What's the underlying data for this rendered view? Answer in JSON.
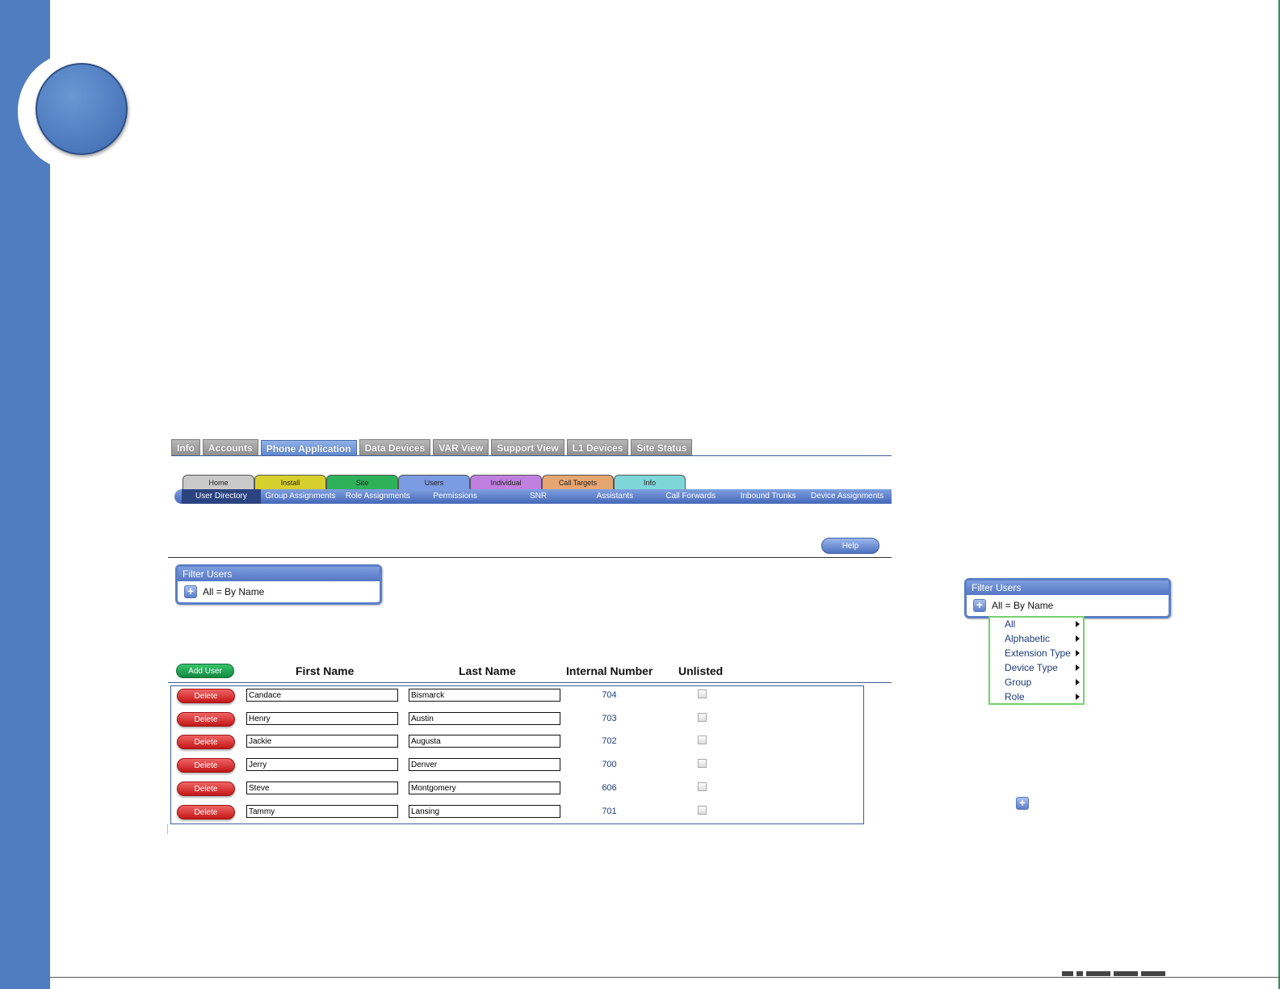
{
  "top_tabs": [
    {
      "label": "Info",
      "active": false
    },
    {
      "label": "Accounts",
      "active": false
    },
    {
      "label": "Phone Application",
      "active": true
    },
    {
      "label": "Data Devices",
      "active": false
    },
    {
      "label": "VAR View",
      "active": false
    },
    {
      "label": "Support View",
      "active": false
    },
    {
      "label": "L1 Devices",
      "active": false
    },
    {
      "label": "Site Status",
      "active": false
    }
  ],
  "section_tabs": [
    {
      "label": "Home",
      "color": "#c9c9c9"
    },
    {
      "label": "Install",
      "color": "#d7cf2e"
    },
    {
      "label": "Site",
      "color": "#2fb15a"
    },
    {
      "label": "Users",
      "color": "#7b9be2"
    },
    {
      "label": "Individual",
      "color": "#c080e0"
    },
    {
      "label": "Call Targets",
      "color": "#e6a672"
    },
    {
      "label": "Info",
      "color": "#7ed6d8"
    }
  ],
  "sub_nav": [
    {
      "label": "User Directory",
      "active": true
    },
    {
      "label": "Group Assignments",
      "active": false
    },
    {
      "label": "Role Assignments",
      "active": false
    },
    {
      "label": "Permissions",
      "active": false
    },
    {
      "label": "SNR",
      "active": false
    },
    {
      "label": "Assistants",
      "active": false
    },
    {
      "label": "Call Forwards",
      "active": false
    },
    {
      "label": "Inbound Trunks",
      "active": false
    },
    {
      "label": "Device Assignments",
      "active": false
    }
  ],
  "help_label": "Help",
  "filter": {
    "title": "Filter Users",
    "value": "All = By Name"
  },
  "filter_right": {
    "title": "Filter Users",
    "value": "All = By Name"
  },
  "add_user_label": "Add User",
  "columns": {
    "first_name": "First Name",
    "last_name": "Last Name",
    "internal_number": "Internal Number",
    "unlisted": "Unlisted"
  },
  "delete_label": "Delete",
  "users": [
    {
      "first": "Candace",
      "last": "Bismarck",
      "number": "704",
      "unlisted": false
    },
    {
      "first": "Henry",
      "last": "Austin",
      "number": "703",
      "unlisted": false
    },
    {
      "first": "Jackie",
      "last": "Augusta",
      "number": "702",
      "unlisted": false
    },
    {
      "first": "Jerry",
      "last": "Denver",
      "number": "700",
      "unlisted": false
    },
    {
      "first": "Steve",
      "last": "Montgomery",
      "number": "606",
      "unlisted": false
    },
    {
      "first": "Tammy",
      "last": "Lansing",
      "number": "701",
      "unlisted": false
    }
  ],
  "filter_menu": [
    "All",
    "Alphabetic",
    "Extension Type",
    "Device Type",
    "Group",
    "Role"
  ],
  "icons": {
    "plus": "plus-icon",
    "submenu_arrow": "chevron-right-icon"
  },
  "colors": {
    "sidebar": "#4f7dbf",
    "accent_blue": "#5577c4",
    "delete_red": "#c41818",
    "add_green": "#138a40",
    "menu_border": "#74d26b"
  }
}
